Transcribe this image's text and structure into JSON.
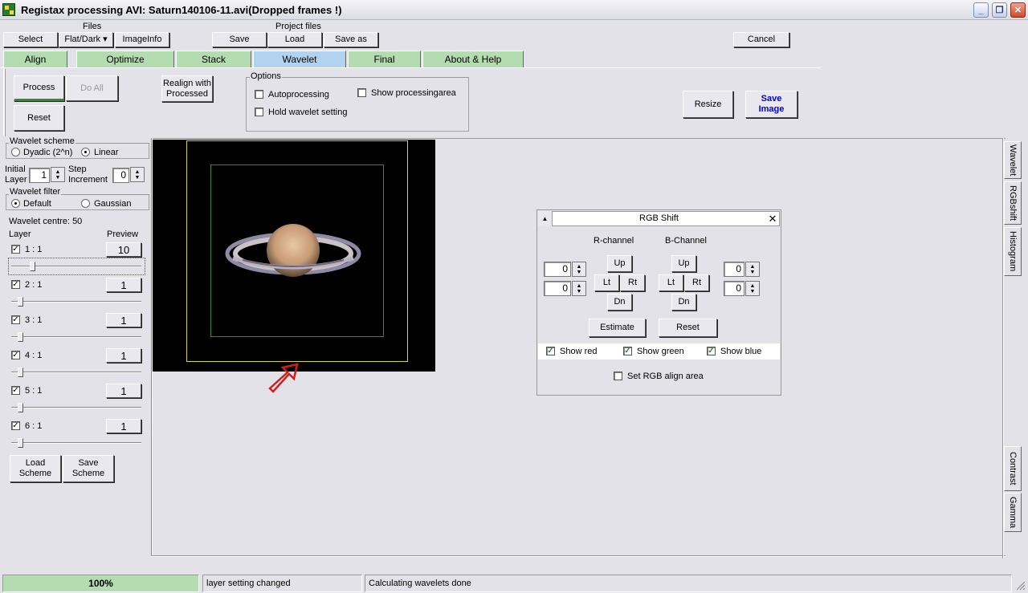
{
  "window": {
    "title": "Registax processing AVI: Saturn140106-11.avi(Dropped frames !)"
  },
  "toolbar": {
    "files_label": "Files",
    "project_files_label": "Project files",
    "select": "Select",
    "flatdark": "Flat/Dark ▾",
    "imageinfo": "ImageInfo",
    "save": "Save",
    "load": "Load",
    "save_as": "Save as",
    "cancel": "Cancel"
  },
  "tabs": [
    {
      "label": "Align"
    },
    {
      "label": "Optimize"
    },
    {
      "label": "Stack"
    },
    {
      "label": "Wavelet",
      "active": true
    },
    {
      "label": "Final"
    },
    {
      "label": "About & Help"
    }
  ],
  "actions": {
    "process": "Process",
    "do_all": "Do All",
    "reset": "Reset",
    "realign": "Realign with\nProcessed",
    "resize": "Resize",
    "save_image": "Save\nImage"
  },
  "options": {
    "label": "Options",
    "autoprocessing": "Autoprocessing",
    "show_processingarea": "Show processingarea",
    "hold_wavelet": "Hold wavelet setting",
    "autoprocessing_checked": false,
    "show_processingarea_checked": false,
    "hold_wavelet_checked": false
  },
  "wavelet_panel": {
    "scheme_label": "Wavelet scheme",
    "dyadic": "Dyadic (2^n)",
    "linear": "Linear",
    "scheme_selected": "Linear",
    "initial_layer_label": "Initial\nLayer",
    "initial_layer_value": "1",
    "step_increment_label": "Step\nIncrement",
    "step_increment_value": "0",
    "filter_label": "Wavelet filter",
    "default": "Default",
    "gaussian": "Gaussian",
    "filter_selected": "Default",
    "centre": "Wavelet centre: 50",
    "layer_header": "Layer",
    "preview_header": "Preview",
    "layers": [
      {
        "label": "1 : 1",
        "checked": true,
        "preview": "10",
        "slider": 0.16
      },
      {
        "label": "2 : 1",
        "checked": true,
        "preview": "1",
        "slider": 0.07
      },
      {
        "label": "3 : 1",
        "checked": true,
        "preview": "1",
        "slider": 0.07
      },
      {
        "label": "4 : 1",
        "checked": true,
        "preview": "1",
        "slider": 0.07
      },
      {
        "label": "5 : 1",
        "checked": true,
        "preview": "1",
        "slider": 0.07
      },
      {
        "label": "6 : 1",
        "checked": true,
        "preview": "1",
        "slider": 0.07
      }
    ],
    "load_scheme": "Load\nScheme",
    "save_scheme": "Save\nScheme"
  },
  "rgb_shift": {
    "title": "RGB Shift",
    "r_channel": "R-channel",
    "b_channel": "B-Channel",
    "r_x": "0",
    "r_y": "0",
    "b_x": "0",
    "b_y": "0",
    "up": "Up",
    "lt": "Lt",
    "rt": "Rt",
    "dn": "Dn",
    "estimate": "Estimate",
    "reset": "Reset",
    "show_red": "Show red",
    "show_green": "Show green",
    "show_blue": "Show blue",
    "set_rgb_align_area": "Set RGB align area"
  },
  "side_tabs": {
    "wavelet": "Wavelet",
    "rgbshift": "RGBshift",
    "histogram": "Histogram",
    "contrast": "Contrast",
    "gamma": "Gamma"
  },
  "status": {
    "progress": "100%",
    "progress_value": 1.0,
    "message1": "layer setting changed",
    "message2": "Calculating wavelets done"
  },
  "colors": {
    "tab_green": "#b3dcb0",
    "tab_active": "#b2d3ef",
    "save_image_text": "#0000cc",
    "progress_fill": "#b3dcb0",
    "check_green": "#1a9e1a"
  }
}
